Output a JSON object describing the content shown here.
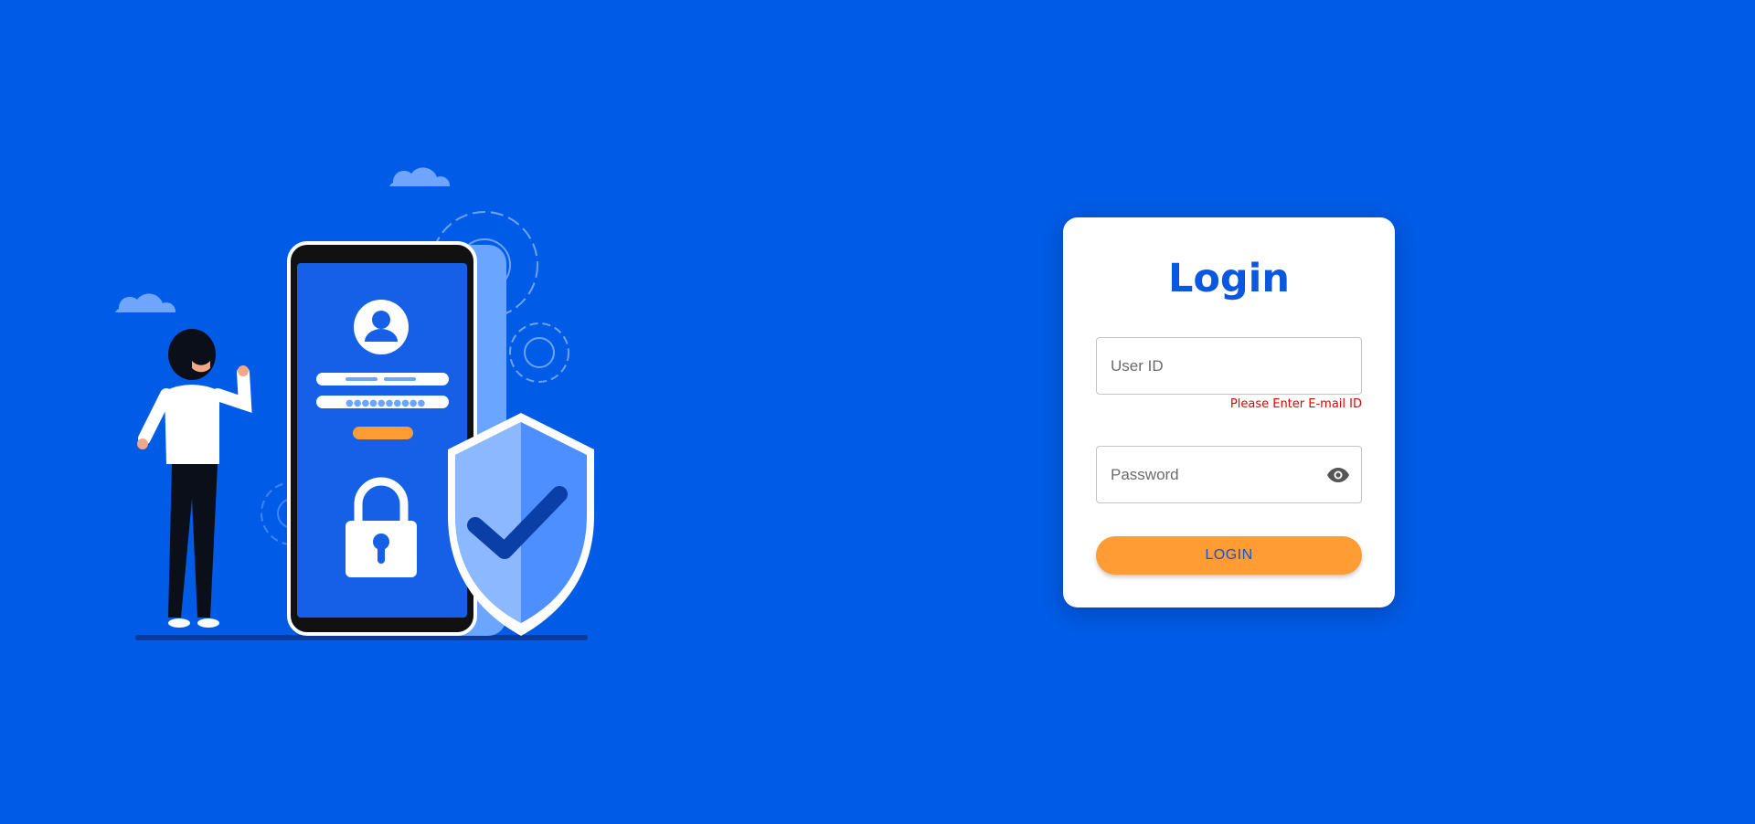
{
  "colors": {
    "background": "#005ce6",
    "card": "#ffffff",
    "title": "#0a57e0",
    "button": "#ff9c33",
    "button_text": "#1a4fd6",
    "error": "#e00000"
  },
  "illustration": {
    "icons": [
      "cloud-icon",
      "gear-icon",
      "phone-icon",
      "user-avatar-icon",
      "padlock-icon",
      "shield-check-icon",
      "person-figure"
    ]
  },
  "login": {
    "title": "Login",
    "userid": {
      "value": "",
      "placeholder": "User ID",
      "error": "Please Enter E-mail ID"
    },
    "password": {
      "value": "",
      "placeholder": "Password",
      "toggle_icon": "eye-icon"
    },
    "button_label": "LOGIN"
  }
}
